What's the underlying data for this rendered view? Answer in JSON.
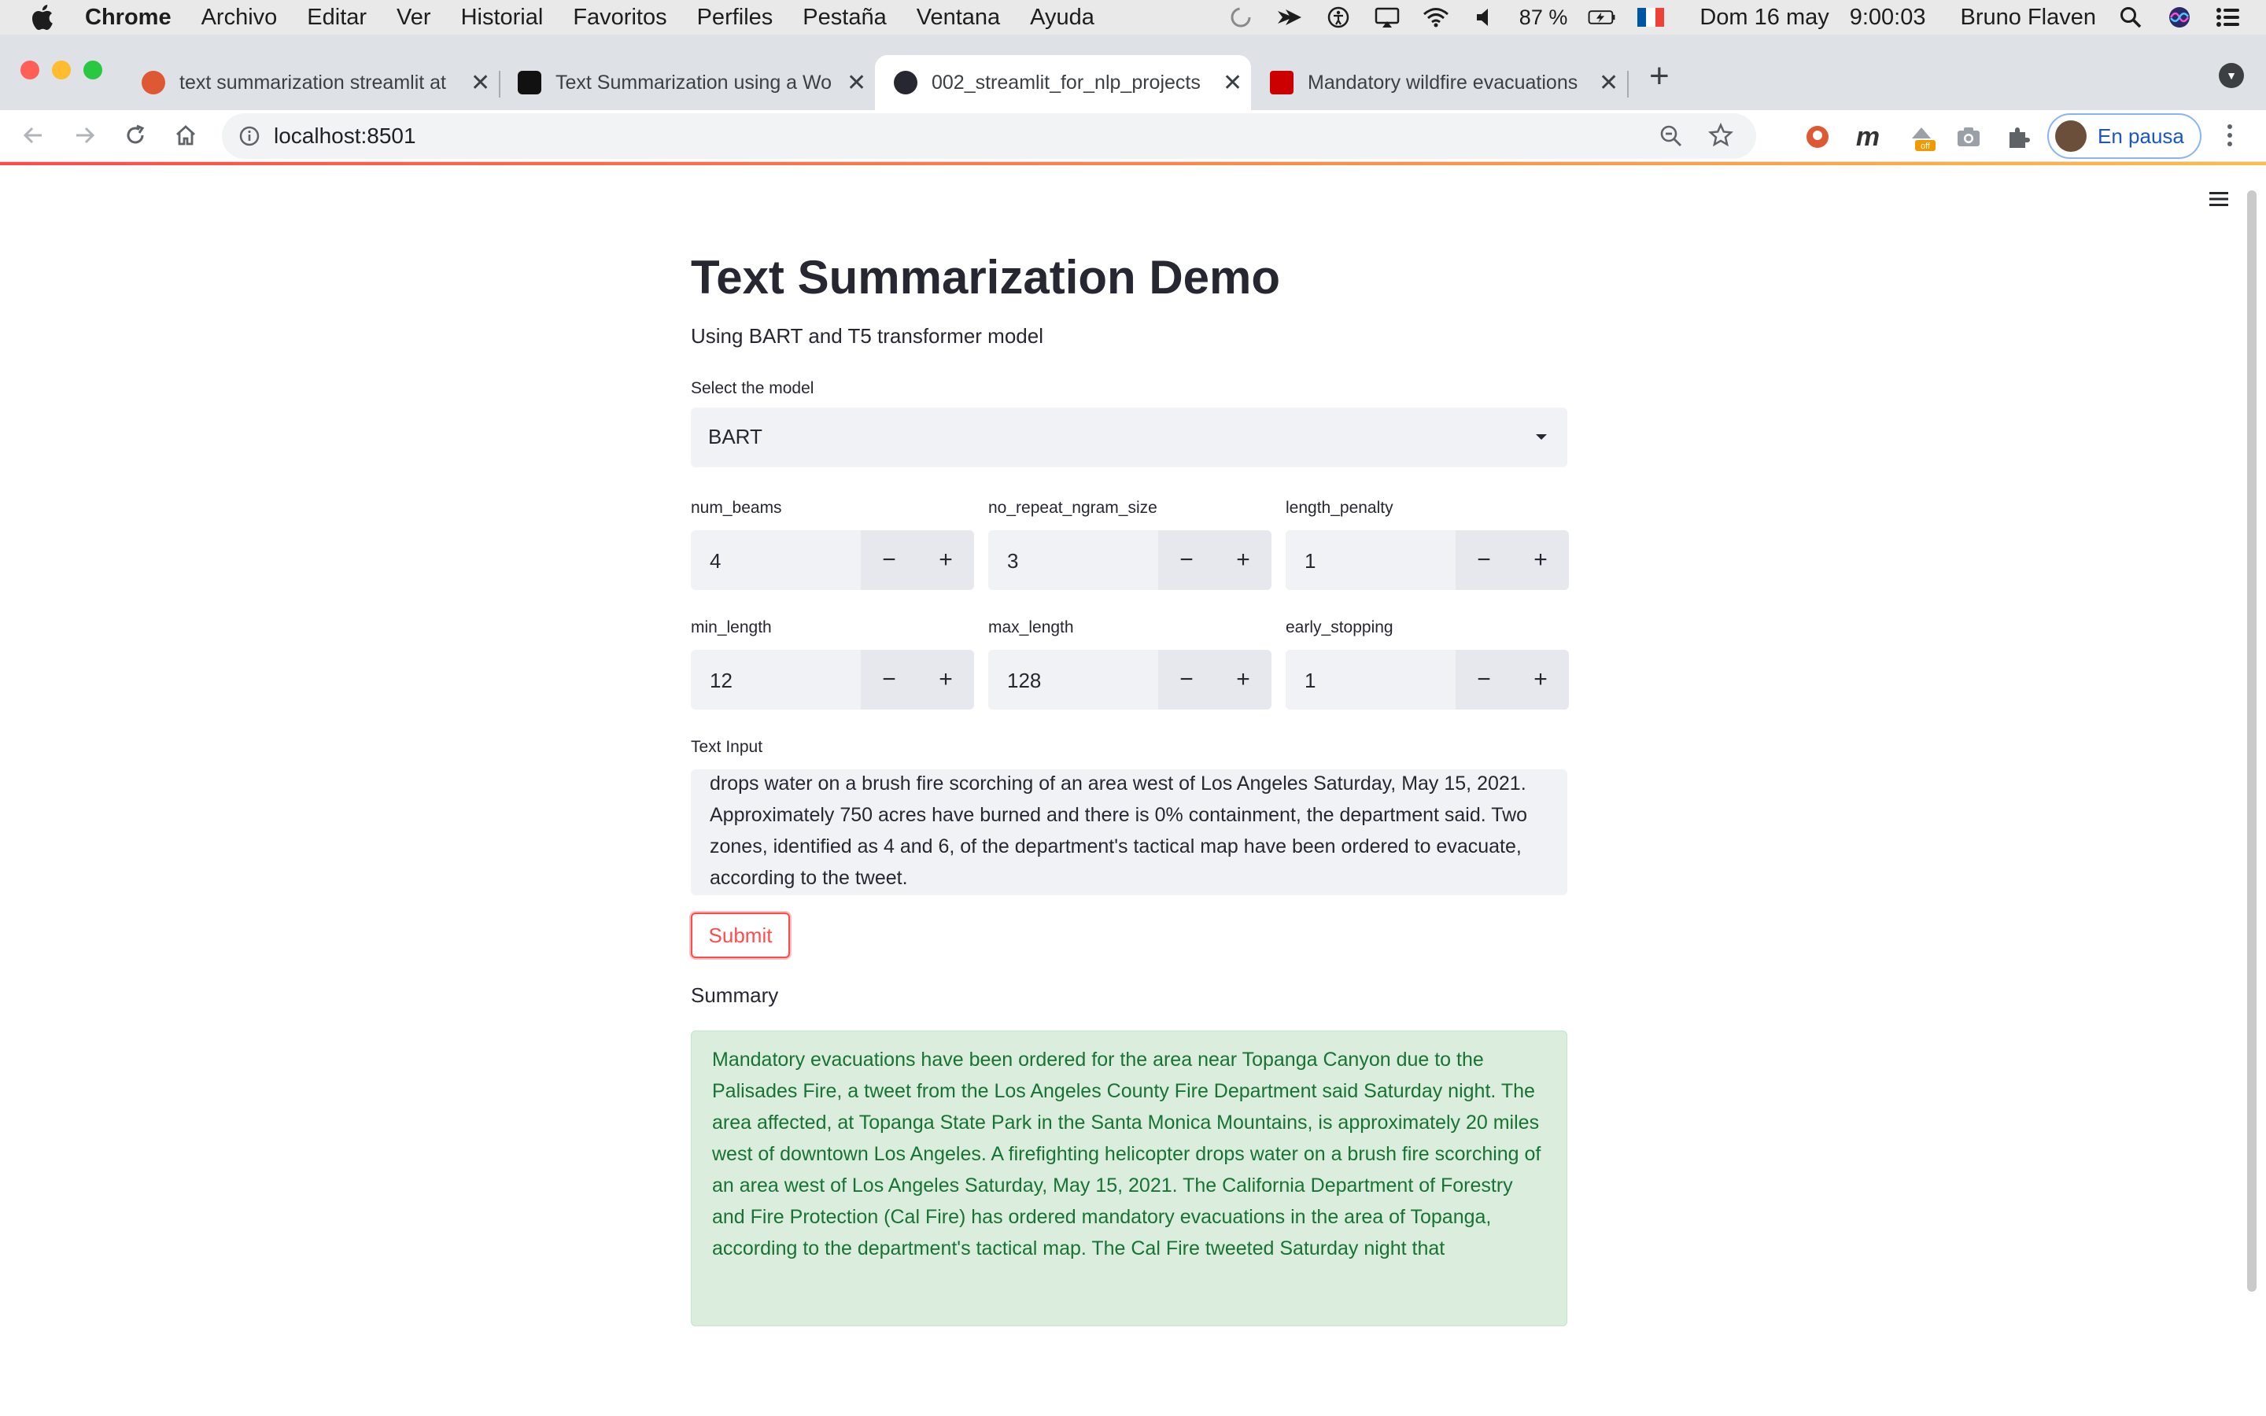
{
  "menubar": {
    "app": "Chrome",
    "items": [
      "Archivo",
      "Editar",
      "Ver",
      "Historial",
      "Favoritos",
      "Perfiles",
      "Pestaña",
      "Ventana",
      "Ayuda"
    ],
    "battery": "87 %",
    "datetime_day": "Dom 16 may",
    "datetime_time": "9:00:03",
    "user": "Bruno Flaven"
  },
  "tabs": [
    {
      "title": "text summarization streamlit at",
      "active": false
    },
    {
      "title": "Text Summarization using a Wo",
      "active": false
    },
    {
      "title": "002_streamlit_for_nlp_projects",
      "active": true
    },
    {
      "title": "Mandatory wildfire evacuations",
      "active": false
    }
  ],
  "toolbar": {
    "url": "localhost:8501",
    "profile_label": "En pausa",
    "ext_badge": "off"
  },
  "app": {
    "title": "Text Summarization Demo",
    "subtitle": "Using BART and T5 transformer model",
    "model_label": "Select the model",
    "model_value": "BART",
    "params": {
      "num_beams": {
        "label": "num_beams",
        "value": "4"
      },
      "no_repeat_ngram_size": {
        "label": "no_repeat_ngram_size",
        "value": "3"
      },
      "length_penalty": {
        "label": "length_penalty",
        "value": "1"
      },
      "min_length": {
        "label": "min_length",
        "value": "12"
      },
      "max_length": {
        "label": "max_length",
        "value": "128"
      },
      "early_stopping": {
        "label": "early_stopping",
        "value": "1"
      }
    },
    "minus": "−",
    "plus": "+",
    "text_input_label": "Text Input",
    "text_input_value": "drops water on a brush fire scorching of an area west of Los Angeles Saturday, May 15, 2021. Approximately 750 acres have burned and there is 0% containment, the department said. Two zones, identified as 4 and 6, of the department's tactical map have been ordered to evacuate, according to the tweet.",
    "submit_label": "Submit",
    "summary_label": "Summary",
    "summary_text": "Mandatory evacuations have been ordered for the area near Topanga Canyon due to the Palisades Fire, a tweet from the Los Angeles County Fire Department said Saturday night. The area affected, at Topanga State Park in the Santa Monica Mountains, is approximately 20 miles west of downtown Los Angeles. A firefighting helicopter drops water on a brush fire scorching of an area west of Los Angeles Saturday, May 15, 2021. The California Department of Forestry and Fire Protection (Cal Fire) has ordered mandatory evacuations in the area of Topanga, according to the department's tactical map. The Cal Fire tweeted Saturday night that"
  },
  "colors": {
    "accent": "#ff4b4b",
    "success_bg": "#dbeedd",
    "success_text": "#177233",
    "input_bg": "#f0f2f6"
  }
}
